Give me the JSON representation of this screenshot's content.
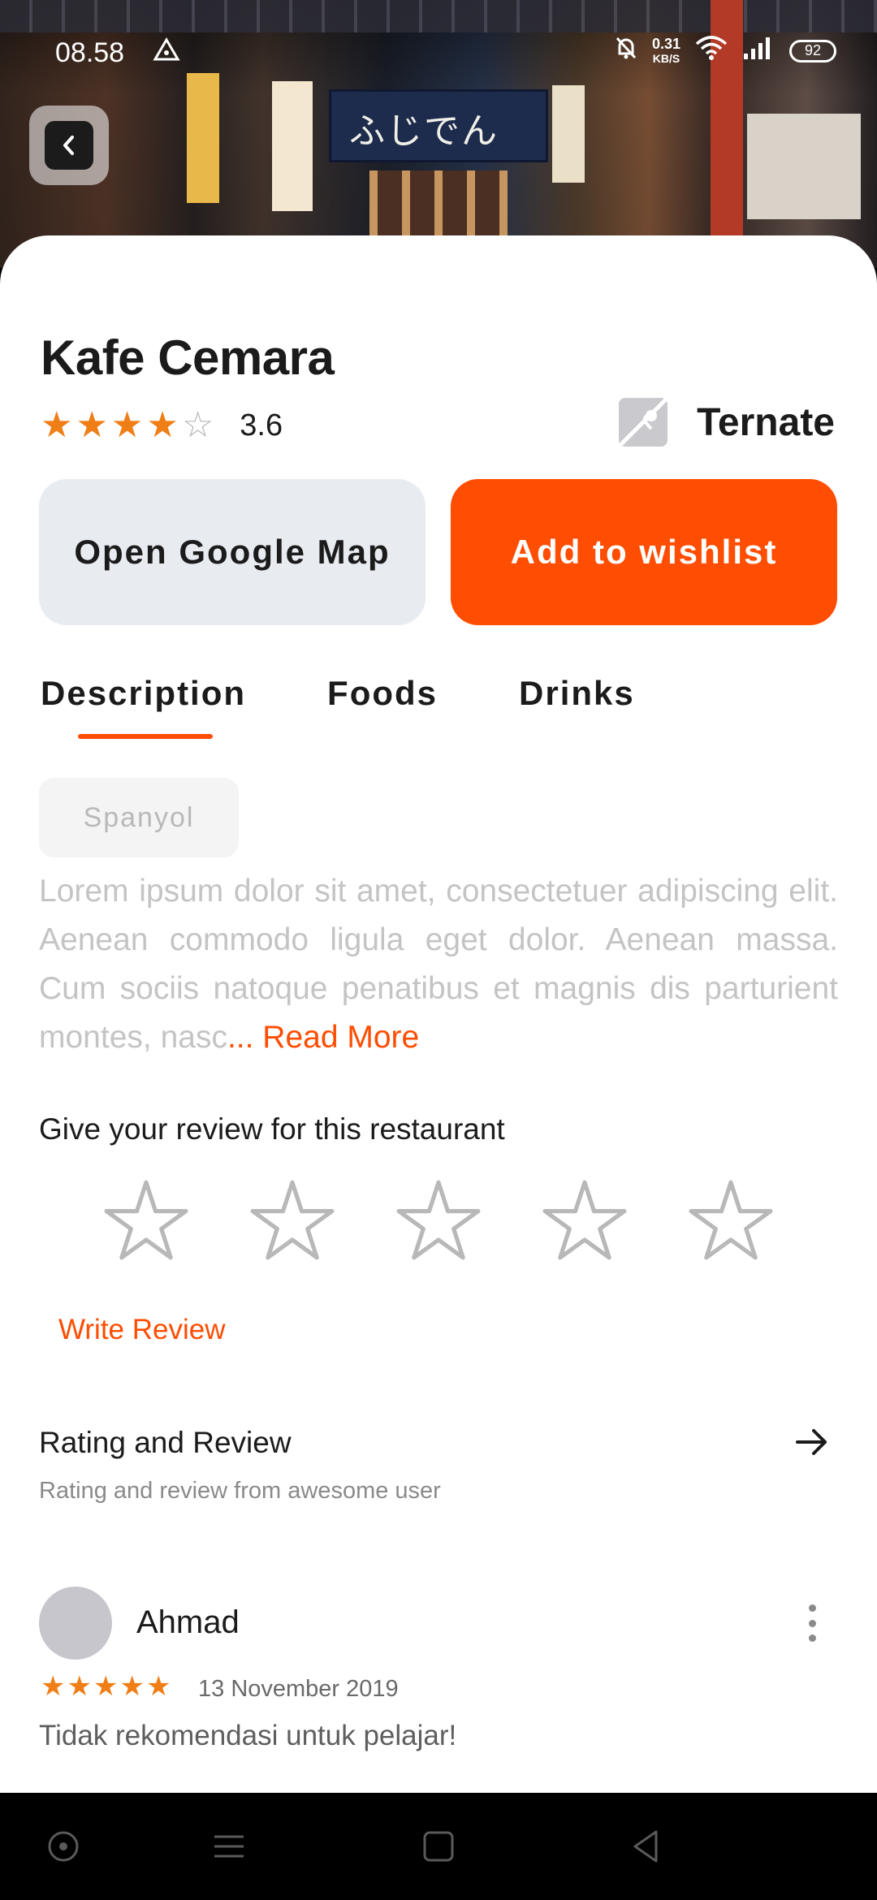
{
  "status_bar": {
    "time": "08.58",
    "net_speed_value": "0.31",
    "net_speed_unit": "KB/S",
    "battery": "92"
  },
  "place": {
    "name": "Kafe Cemara",
    "rating": 3.6,
    "rating_label": "3.6",
    "stars_filled": 4,
    "stars_total": 5,
    "location": "Ternate"
  },
  "actions": {
    "open_map": "Open Google Map",
    "wishlist": "Add to wishlist"
  },
  "tabs": [
    {
      "label": "Description",
      "active": true
    },
    {
      "label": "Foods",
      "active": false
    },
    {
      "label": "Drinks",
      "active": false
    }
  ],
  "description": {
    "tag": "Spanyol",
    "text": "Lorem ipsum dolor sit amet, consectetuer adipiscing elit. Aenean commodo ligula eget dolor. Aenean massa. Cum sociis natoque penatibus et magnis dis parturient montes, nasc",
    "read_more": "... Read More"
  },
  "review_prompt": {
    "heading": "Give your review for this restaurant",
    "write_label": "Write Review"
  },
  "rating_section": {
    "title": "Rating and Review",
    "subtitle": "Rating and review from awesome user"
  },
  "reviews": [
    {
      "name": "Ahmad",
      "stars": 5,
      "date": "13 November 2019",
      "text": "Tidak rekomendasi untuk pelajar!"
    }
  ],
  "colors": {
    "accent": "#ff4d02",
    "star": "#f07e17",
    "secondary_button": "#e8ebf0"
  }
}
